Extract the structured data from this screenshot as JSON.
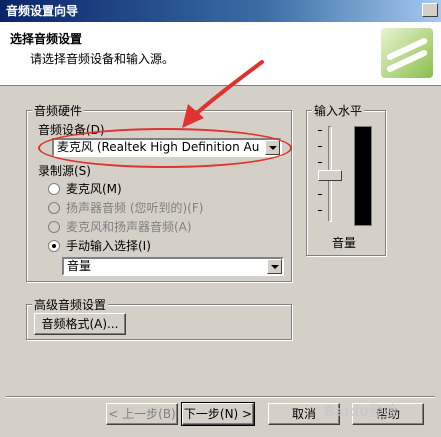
{
  "window": {
    "title": "音频设置向导"
  },
  "header": {
    "title": "选择音频设置",
    "subtitle": "请选择音频设备和输入源。"
  },
  "hardware": {
    "group_label": "音频硬件",
    "device_label": "音频设备(D)",
    "device_value": "麦克风 (Realtek High Definition Au",
    "source_label": "录制源(S)",
    "sources": [
      {
        "label": "麦克风(M)",
        "checked": false,
        "disabled": false
      },
      {
        "label": "扬声器音频 (您听到的)(F)",
        "checked": false,
        "disabled": true
      },
      {
        "label": "麦克风和扬声器音频(A)",
        "checked": false,
        "disabled": true
      },
      {
        "label": "手动输入选择(I)",
        "checked": true,
        "disabled": false
      }
    ],
    "manual_value": "音量"
  },
  "input_level": {
    "group_label": "输入水平",
    "volume_label": "音量"
  },
  "advanced": {
    "group_label": "高级音频设置",
    "format_button": "音频格式(A)..."
  },
  "footer": {
    "back": "< 上一步(B)",
    "next": "下一步(N) >",
    "cancel": "取消",
    "help": "帮助"
  },
  "watermark": "Baidu经验",
  "colors": {
    "annotation": "#e0322e",
    "title_bar": "#0a246a"
  }
}
